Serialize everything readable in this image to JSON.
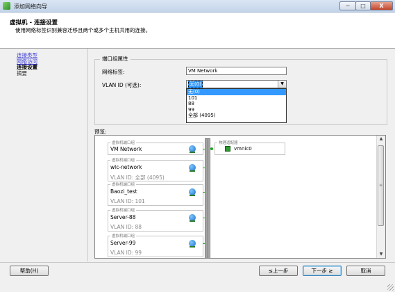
{
  "window": {
    "title": "添加网络向导",
    "minimize_label": "─",
    "maximize_label": "□",
    "close_label": "X"
  },
  "header": {
    "title": "虚拟机 - 连接设置",
    "subtitle": "使用网络标签识别兼容迁移且两个或多个主机共用的连接。"
  },
  "nav": {
    "items": [
      {
        "label": "连接类型",
        "state": "link"
      },
      {
        "label": "网络访问",
        "state": "link"
      },
      {
        "label": "连接设置",
        "state": "current"
      },
      {
        "label": "摘要",
        "state": "pending"
      }
    ]
  },
  "port_group_properties": {
    "legend": "端口组属性",
    "network_label_caption": "网络标签:",
    "network_label_value": "VM Network",
    "vlan_caption": "VLAN ID (可选):",
    "vlan_selected": "无(0)",
    "vlan_options": [
      "无(0)",
      "101",
      "88",
      "99",
      "全部 (4095)"
    ]
  },
  "preview": {
    "label": "预览:",
    "port_group_caption": "虚拟机端口组",
    "physical_caption": "物理适配器",
    "physical_adapter": "vmnic0",
    "port_groups": [
      {
        "name": "VM Network",
        "vlan_prefix": "",
        "vlan": ""
      },
      {
        "name": "wlc-network",
        "vlan_prefix": "VLAN ID: ",
        "vlan": "全部 (4095)"
      },
      {
        "name": "Baozi_test",
        "vlan_prefix": "VLAN ID: ",
        "vlan": "101"
      },
      {
        "name": "Server-88",
        "vlan_prefix": "VLAN ID: ",
        "vlan": "88"
      },
      {
        "name": "Server-99",
        "vlan_prefix": "VLAN ID: ",
        "vlan": "99"
      }
    ]
  },
  "buttons": {
    "help": "帮助(H)",
    "back": "≤上一步",
    "next": "下一步 ≥",
    "cancel": "取消"
  },
  "colors": {
    "selection": "#3399ff",
    "link": "#3b3bd6",
    "adapter_green": "#2f9a2f"
  }
}
